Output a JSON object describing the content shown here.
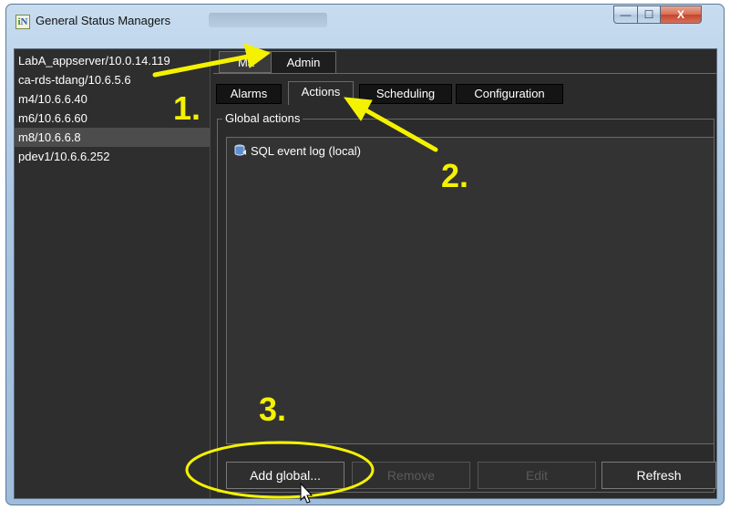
{
  "window": {
    "title": "General Status Managers",
    "controls": {
      "minimize": "—",
      "maximize": "☐",
      "close": "X"
    }
  },
  "servers": [
    {
      "label": "LabA_appserver/10.0.14.119",
      "selected": false
    },
    {
      "label": "ca-rds-tdang/10.6.5.6",
      "selected": false
    },
    {
      "label": "m4/10.6.6.40",
      "selected": false
    },
    {
      "label": "m6/10.6.6.60",
      "selected": false
    },
    {
      "label": "m8/10.6.6.8",
      "selected": true
    },
    {
      "label": "pdev1/10.6.6.252",
      "selected": false
    }
  ],
  "top_tabs": {
    "main": "Ma",
    "admin": "Admin"
  },
  "sub_tabs": {
    "alarms": "Alarms",
    "actions": "Actions",
    "scheduling": "Scheduling",
    "configuration": "Configuration"
  },
  "global_actions": {
    "legend": "Global actions",
    "items": [
      {
        "label": "SQL event log (local)",
        "icon": "database-icon"
      }
    ]
  },
  "buttons": {
    "add_global": "Add global...",
    "remove": "Remove",
    "edit": "Edit",
    "refresh": "Refresh"
  },
  "annotations": {
    "step1": "1.",
    "step2": "2.",
    "step3": "3.",
    "color": "#f4f200"
  }
}
